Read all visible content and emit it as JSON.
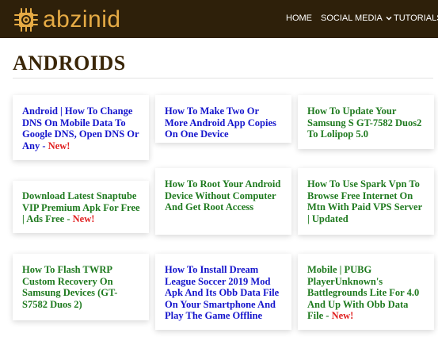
{
  "brand": {
    "name": "abzinid",
    "logo_icon": "chip-icon",
    "colors": {
      "header_bg": "#2e200a",
      "logo": "#e6ab45",
      "title": "#3a2608"
    }
  },
  "nav": {
    "items": [
      {
        "label": "HOME"
      },
      {
        "label": "SOCIAL MEDIA",
        "dropdown_icon": "chevron-down-icon"
      },
      {
        "label": "TUTORIALS"
      }
    ]
  },
  "page": {
    "title": "ANDROIDS"
  },
  "posts": [
    {
      "title": "Android | How To Change DNS On Mobile Data To Google DNS, Open DNS Or Any",
      "badge": "New!",
      "color": "#1515cc"
    },
    {
      "title": "How To Make Two Or More Android App Copies On One Device",
      "badge": "",
      "color": "#1515cc"
    },
    {
      "title": "How To Update Your Samsung S GT-7582 Duos2 To Lolipop 5.0",
      "badge": "",
      "color": "#1f7a1f"
    },
    {
      "title": "Download Latest Snaptube VIP Premium Apk For Free | Ads Free",
      "badge": "New!",
      "color": "#1f7a1f"
    },
    {
      "title": "How To Root Your Android Device Without Computer And Get Root Access",
      "badge": "",
      "color": "#1f7a1f"
    },
    {
      "title": "How To Use Spark Vpn To Browse Free Internet On Mtn With Paid VPS Server | Updated",
      "badge": "",
      "color": "#1f7a1f"
    },
    {
      "title": "How To Flash TWRP Custom Recovery On Samsung Devices (GT-S7582 Duos 2)",
      "badge": "",
      "color": "#1f7a1f"
    },
    {
      "title": "How To Install Dream League Soccer 2019 Mod Apk And Its Obb Data File On Your Smartphone And Play The Game Offline",
      "badge": "",
      "color": "#1515cc"
    },
    {
      "title": "Mobile | PUBG PlayerUnknown's Battlegrounds Lite For 4.0 And Up With Obb Data File",
      "badge": "New!",
      "color": "#1f7a1f"
    }
  ]
}
